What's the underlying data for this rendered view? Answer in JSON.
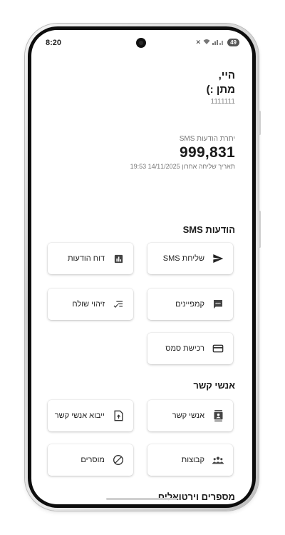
{
  "status": {
    "time": "8:20",
    "battery": "49"
  },
  "greeting": {
    "line1": "היי,",
    "line2": "מתן :)",
    "phone": "1111111"
  },
  "balance": {
    "label": "יתרת הודעות SMS",
    "value": "999,831",
    "last_send": "תאריך שליחה אחרון 14/11/2025 19:53"
  },
  "sections": {
    "sms": {
      "title": "הודעות SMS",
      "send_sms": "שליחת SMS",
      "report": "דוח הודעות",
      "campaigns": "קמפיינים",
      "sender_id": "זיהוי שולח",
      "buy_sms": "רכישת סמס"
    },
    "contacts": {
      "title": "אנשי קשר",
      "contacts": "אנשי קשר",
      "import": "ייבוא אנשי קשר",
      "groups": "קבוצות",
      "blocked": "מוסרים"
    },
    "virtual": {
      "title": "מספרים וירטואלים"
    }
  },
  "icons": {
    "send": "send-icon",
    "report": "bar-chart-icon",
    "campaigns": "message-icon",
    "sender_id": "checklist-icon",
    "buy": "credit-card-icon",
    "contacts": "contacts-book-icon",
    "import": "file-upload-icon",
    "groups": "group-icon",
    "blocked": "block-icon"
  },
  "colors": {
    "text": "#1a1a1a",
    "muted": "#777777",
    "icon": "#333333"
  }
}
